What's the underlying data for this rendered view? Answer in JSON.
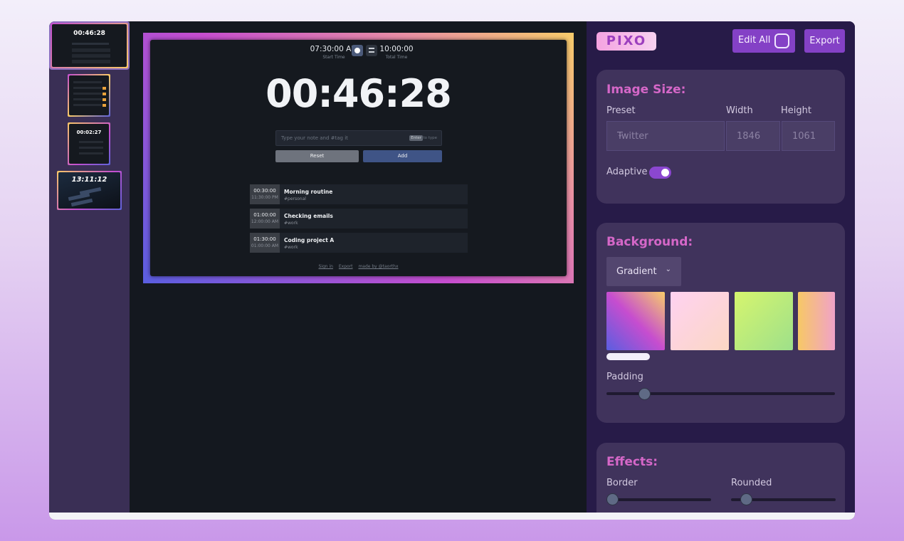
{
  "thumbnails": {
    "items": [
      {
        "clock": "00:46:28"
      },
      {
        "clock": ""
      },
      {
        "clock": "00:02:27"
      },
      {
        "clock": "13:11:12"
      }
    ]
  },
  "preview": {
    "start_time": "07:30:00 AM",
    "start_label": "Start Time",
    "total_time": "10:00:00",
    "total_label": "Total Time",
    "clock": "00:46:28",
    "note_placeholder": "Type your note and #tag it",
    "enter_key": "Enter",
    "enter_hint": "to type",
    "reset_label": "Reset",
    "add_label": "Add",
    "entries": [
      {
        "duration": "00:30:00",
        "time": "11:30:00 PM",
        "title": "Morning routine",
        "tag": "#personal"
      },
      {
        "duration": "01:00:00",
        "time": "12:00:00 AM",
        "title": "Checking emails",
        "tag": "#work"
      },
      {
        "duration": "01:30:00",
        "time": "01:00:00 AM",
        "title": "Coding project A",
        "tag": "#work"
      }
    ],
    "footer": {
      "sign_in": "Sign in",
      "export": "Export",
      "made_by": "made by @taorthx"
    }
  },
  "panel": {
    "logo": "PIXO",
    "edit_all_label": "Edit All",
    "export_label": "Export",
    "image_size": {
      "title": "Image Size:",
      "preset_label": "Preset",
      "preset_value": "Twitter",
      "width_label": "Width",
      "width_value": "1846",
      "height_label": "Height",
      "height_value": "1061",
      "adaptive_label": "Adaptive",
      "adaptive_on": true
    },
    "background": {
      "title": "Background:",
      "type_value": "Gradient",
      "padding_label": "Padding",
      "padding_value": 0.17
    },
    "effects": {
      "title": "Effects:",
      "border_label": "Border",
      "border_value": 0.0,
      "rounded_label": "Rounded",
      "rounded_value": 0.14
    }
  },
  "colors": {
    "accent": "#8441c6",
    "heading": "#d567c8",
    "panel_bg": "#271b48",
    "card_bg": "#40335c"
  }
}
